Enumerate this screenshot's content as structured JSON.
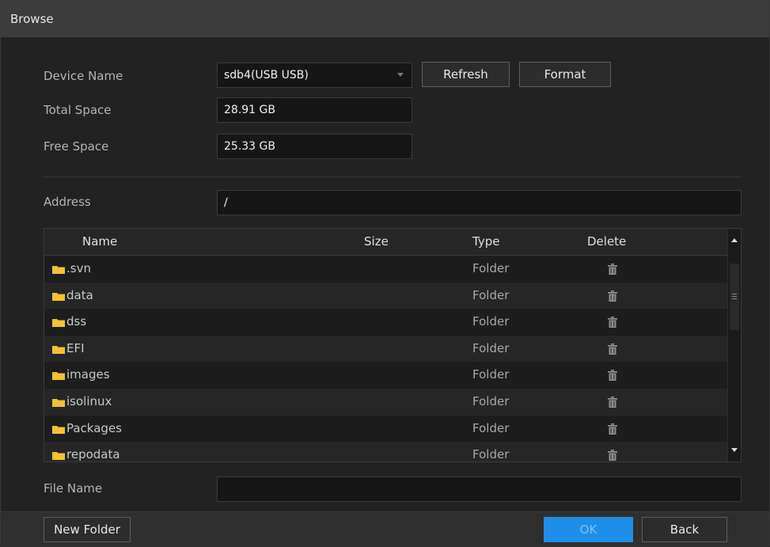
{
  "window": {
    "title": "Browse"
  },
  "device": {
    "name_label": "Device Name",
    "name_value": "sdb4(USB USB)",
    "refresh_label": "Refresh",
    "format_label": "Format",
    "total_label": "Total Space",
    "total_value": "28.91 GB",
    "free_label": "Free Space",
    "free_value": "25.33 GB"
  },
  "address": {
    "label": "Address",
    "value": "/"
  },
  "table": {
    "columns": {
      "name": "Name",
      "size": "Size",
      "type": "Type",
      "delete": "Delete"
    },
    "rows": [
      {
        "name": ".svn",
        "size": "",
        "type": "Folder",
        "icon": "folder-icon"
      },
      {
        "name": "data",
        "size": "",
        "type": "Folder",
        "icon": "folder-icon"
      },
      {
        "name": "dss",
        "size": "",
        "type": "Folder",
        "icon": "folder-icon"
      },
      {
        "name": "EFI",
        "size": "",
        "type": "Folder",
        "icon": "folder-icon"
      },
      {
        "name": "images",
        "size": "",
        "type": "Folder",
        "icon": "folder-icon"
      },
      {
        "name": "isolinux",
        "size": "",
        "type": "Folder",
        "icon": "folder-icon"
      },
      {
        "name": "Packages",
        "size": "",
        "type": "Folder",
        "icon": "folder-icon"
      },
      {
        "name": "repodata",
        "size": "",
        "type": "Folder",
        "icon": "folder-icon"
      }
    ]
  },
  "file": {
    "label": "File Name",
    "value": ""
  },
  "footer": {
    "new_folder_label": "New Folder",
    "ok_label": "OK",
    "back_label": "Back"
  },
  "colors": {
    "folder": "#f2c230",
    "accent": "#1f8ee8",
    "background": "#222222",
    "titlebar": "#3c3c3c"
  }
}
